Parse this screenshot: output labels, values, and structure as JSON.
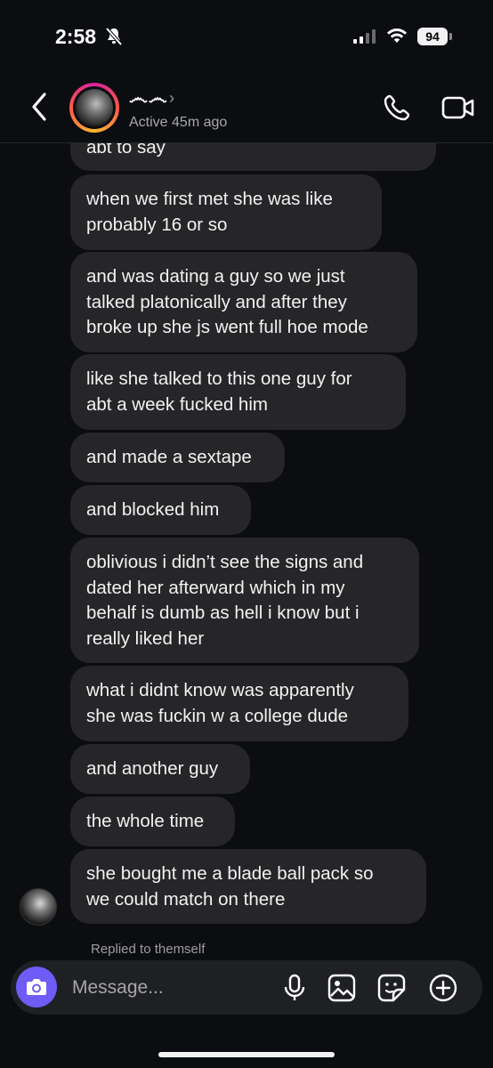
{
  "status_bar": {
    "time": "2:58",
    "battery": "94"
  },
  "header": {
    "username": "෴෴",
    "active_status": "Active 45m ago"
  },
  "messages": [
    {
      "text": "abt to say"
    },
    {
      "text": "when we first met she was like\nprobably 16 or so"
    },
    {
      "text": "and was dating a guy so we just\ntalked platonically and after they\nbroke up she js went full hoe mode"
    },
    {
      "text": "like she talked to this one guy for\nabt a week fucked him"
    },
    {
      "text": "and made a sextape"
    },
    {
      "text": "and blocked him"
    },
    {
      "text": "oblivious i didn’t see the signs and\ndated her afterward which in my\nbehalf is dumb as hell i know but i\nreally liked her"
    },
    {
      "text": "what i didnt know was apparently\nshe was fuckin w a college dude"
    },
    {
      "text": "and another guy"
    },
    {
      "text": "the whole time"
    },
    {
      "text": "she bought me a blade ball pack so\nwe could match on there"
    }
  ],
  "replied_label": "Replied to themself",
  "composer": {
    "placeholder": "Message..."
  },
  "colors": {
    "background": "#0c0d10",
    "bubble": "#262629",
    "camera_button": "#6f5bf5"
  },
  "icons": [
    "silent-bell-icon",
    "signal-icon",
    "wifi-icon",
    "back-icon",
    "chevron-right-icon",
    "phone-icon",
    "video-icon",
    "camera-icon",
    "microphone-icon",
    "gallery-icon",
    "sticker-icon",
    "plus-icon"
  ]
}
